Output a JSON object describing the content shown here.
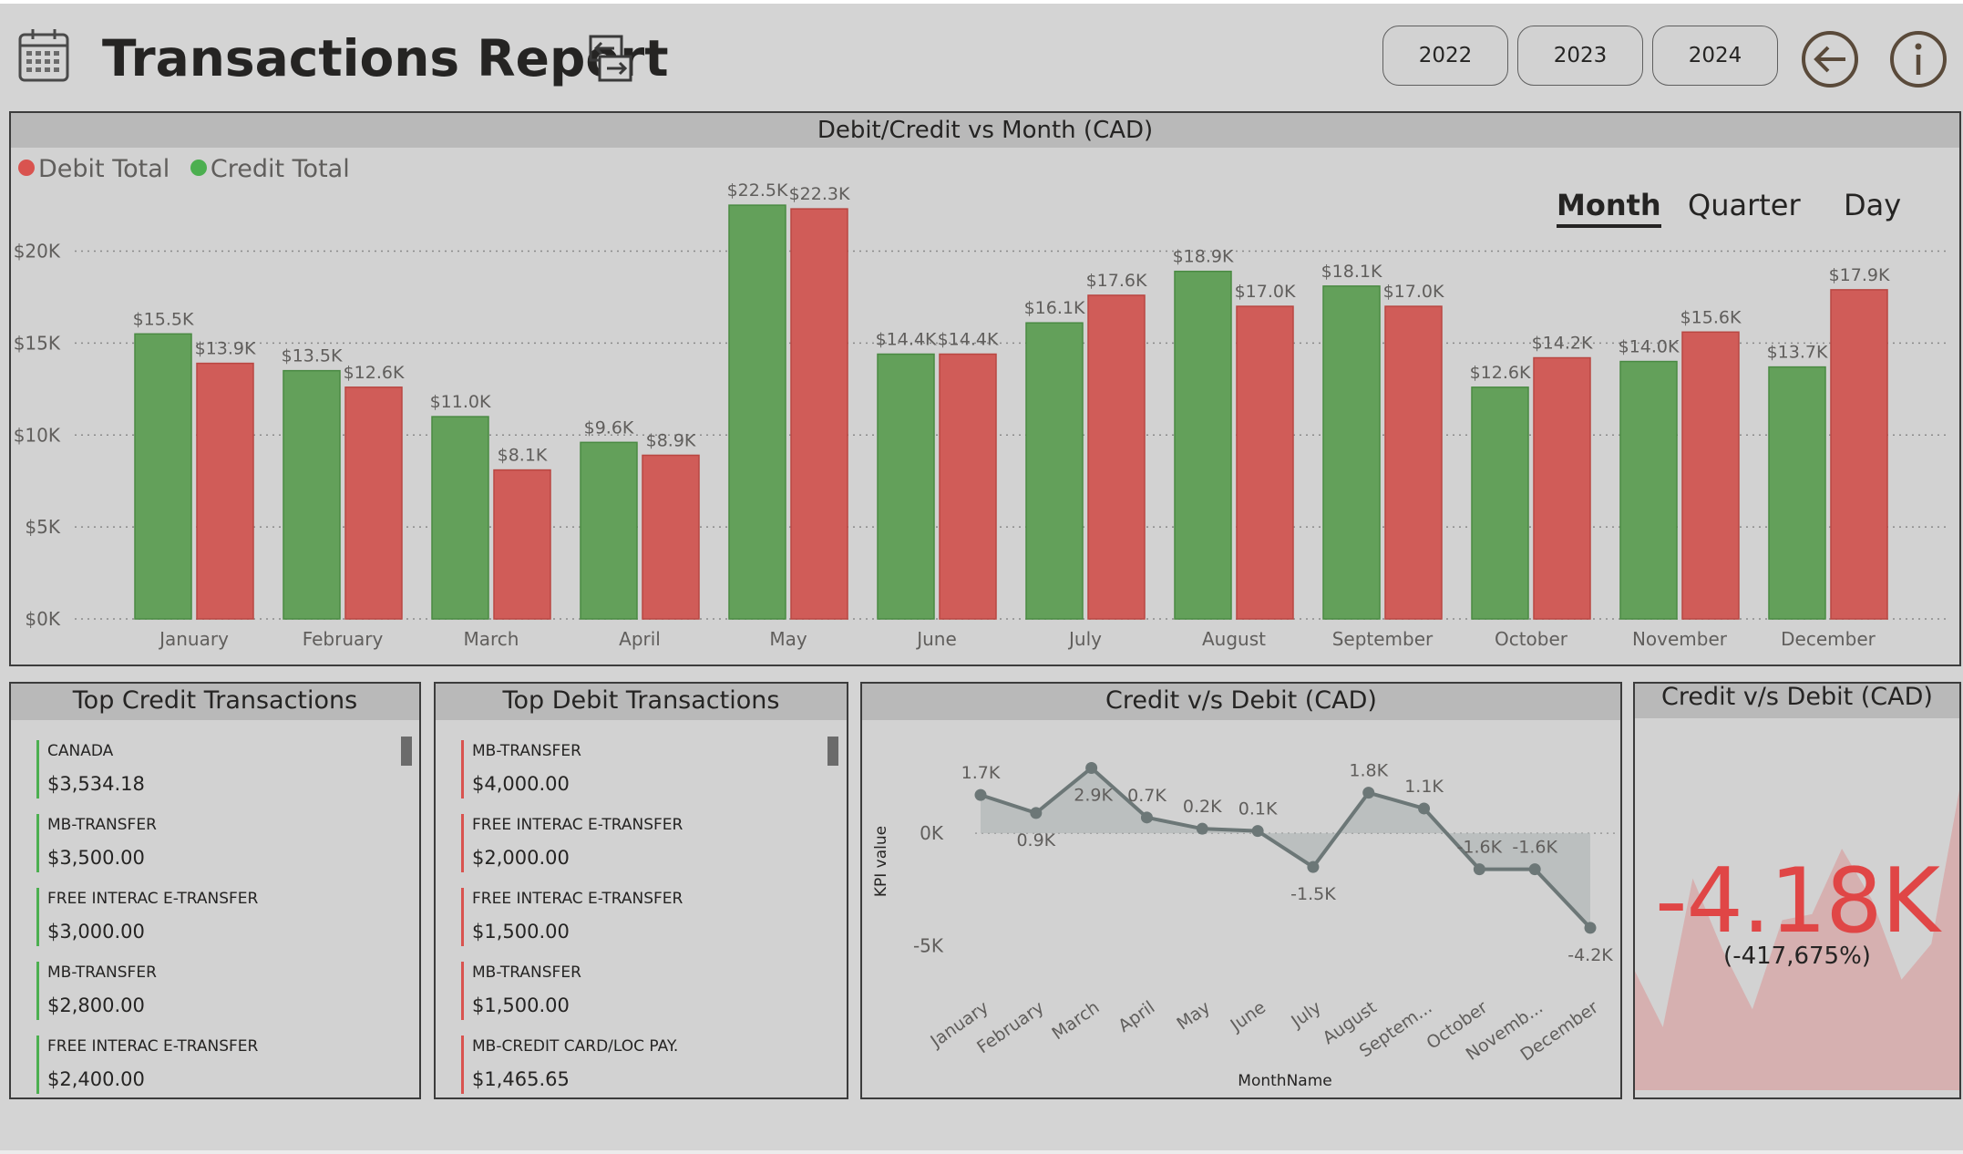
{
  "header": {
    "title": "Transactions Report",
    "year_buttons": [
      "2022",
      "2023",
      "2024"
    ],
    "icons": [
      "calendar-icon",
      "swap-arrows-icon",
      "back-arrow-icon",
      "info-icon"
    ]
  },
  "colors": {
    "credit": "#63a05a",
    "debit": "#d05c58",
    "kpi_negative": "#e04646",
    "header_bg": "#b9b9b9"
  },
  "main_chart": {
    "title": "Debit/Credit vs Month (CAD)",
    "legend": [
      "Debit Total",
      "Credit Total"
    ],
    "granularity": {
      "options": [
        "Month",
        "Quarter",
        "Day"
      ],
      "selected": "Month"
    }
  },
  "chart_data": [
    {
      "type": "bar",
      "title": "Debit/Credit vs Month (CAD)",
      "categories": [
        "January",
        "February",
        "March",
        "April",
        "May",
        "June",
        "July",
        "August",
        "September",
        "October",
        "November",
        "December"
      ],
      "series": [
        {
          "name": "Credit Total",
          "values": [
            15500,
            13500,
            11000,
            9600,
            22500,
            14400,
            16100,
            18900,
            18100,
            12600,
            14000,
            13700
          ],
          "labels": [
            "$15.5K",
            "$13.5K",
            "$11.0K",
            "$9.6K",
            "$22.5K",
            "$14.4K",
            "$16.1K",
            "$18.9K",
            "$18.1K",
            "$12.6K",
            "$14.0K",
            "$13.7K"
          ]
        },
        {
          "name": "Debit Total",
          "values": [
            13900,
            12600,
            8100,
            8900,
            22300,
            14400,
            17600,
            17000,
            17000,
            14200,
            15600,
            17900
          ],
          "labels": [
            "$13.9K",
            "$12.6K",
            "$8.1K",
            "$8.9K",
            "$22.3K",
            "$14.4K",
            "$17.6K",
            "$17.0K",
            "$17.0K",
            "$14.2K",
            "$15.6K",
            "$17.9K"
          ]
        }
      ],
      "y_ticks": [
        "$0K",
        "$5K",
        "$10K",
        "$15K",
        "$20K"
      ],
      "y_tick_values": [
        0,
        5000,
        10000,
        15000,
        20000
      ],
      "ylim": [
        0,
        23000
      ],
      "grid": true,
      "legend_position": "top-left"
    },
    {
      "type": "line",
      "title": "Credit v/s Debit (CAD)",
      "xlabel": "MonthName",
      "ylabel": "KPI value",
      "categories": [
        "January",
        "February",
        "March",
        "April",
        "May",
        "June",
        "July",
        "August",
        "Septem...",
        "October",
        "Novemb...",
        "December"
      ],
      "series": [
        {
          "values": [
            1700,
            900,
            2900,
            700,
            200,
            100,
            -1500,
            1800,
            1100,
            -1600,
            -1600,
            -4200
          ],
          "labels": [
            "1.7K",
            "0.9K",
            "2.9K",
            "0.7K",
            "0.2K",
            "0.1K",
            "-1.5K",
            "1.8K",
            "1.1K",
            "-1.6K",
            "-1.6K",
            "-4.2K"
          ]
        }
      ],
      "y_ticks": [
        "0K",
        "-5K"
      ],
      "y_tick_values": [
        0,
        -5000
      ],
      "ylim": [
        -5500,
        3000
      ],
      "grid": true
    }
  ],
  "top_credit": {
    "title": "Top Credit Transactions",
    "items": [
      {
        "name": "CANADA",
        "amount": "$3,534.18"
      },
      {
        "name": "MB-TRANSFER",
        "amount": "$3,500.00"
      },
      {
        "name": "FREE INTERAC E-TRANSFER",
        "amount": "$3,000.00"
      },
      {
        "name": "MB-TRANSFER",
        "amount": "$2,800.00"
      },
      {
        "name": "FREE INTERAC E-TRANSFER",
        "amount": "$2,400.00"
      }
    ]
  },
  "top_debit": {
    "title": "Top Debit Transactions",
    "items": [
      {
        "name": "MB-TRANSFER",
        "amount": "$4,000.00"
      },
      {
        "name": "FREE INTERAC E-TRANSFER",
        "amount": "$2,000.00"
      },
      {
        "name": "FREE INTERAC E-TRANSFER",
        "amount": "$1,500.00"
      },
      {
        "name": "MB-TRANSFER",
        "amount": "$1,500.00"
      },
      {
        "name": "MB-CREDIT CARD/LOC PAY.",
        "amount": "$1,465.65"
      }
    ]
  },
  "line_chart": {
    "title": "Credit v/s Debit (CAD)",
    "xlabel": "MonthName",
    "ylabel": "KPI value"
  },
  "kpi_card": {
    "title": "Credit v/s Debit (CAD)",
    "value": "-4.18K",
    "percent": "(-417,675%)",
    "sparkline": [
      0.32,
      0.12,
      0.62,
      0.38,
      0.18,
      0.48,
      0.5,
      0.72,
      0.55,
      0.28,
      0.4,
      0.95
    ]
  }
}
